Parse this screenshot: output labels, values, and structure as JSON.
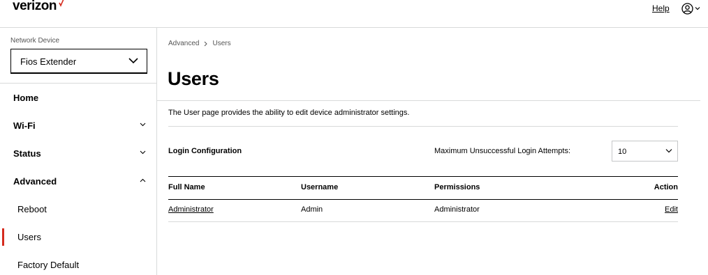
{
  "header": {
    "logo_text": "verizon",
    "help_label": "Help",
    "brand_color": "#d52b1e",
    "user_icon": "user-circle-icon"
  },
  "sidebar": {
    "device_label": "Network Device",
    "device_value": "Fios Extender",
    "items": [
      {
        "label": "Home"
      },
      {
        "label": "Wi-Fi",
        "expanded": false
      },
      {
        "label": "Status",
        "expanded": false
      },
      {
        "label": "Advanced",
        "expanded": true
      }
    ],
    "sub_items": [
      {
        "label": "Reboot",
        "active": false
      },
      {
        "label": "Users",
        "active": true
      },
      {
        "label": "Factory Default",
        "active": false
      }
    ]
  },
  "main": {
    "breadcrumb": [
      "Advanced",
      "Users"
    ],
    "title": "Users",
    "description": "The User page provides the ability to edit device administrator settings.",
    "login_config_label": "Login Configuration",
    "max_attempts_label": "Maximum Unsuccessful Login Attempts:",
    "max_attempts_value": "10",
    "table": {
      "headers": [
        "Full Name",
        "Username",
        "Permissions",
        "Action"
      ],
      "rows": [
        {
          "full_name": "Administrator",
          "username": "Admin",
          "permissions": "Administrator",
          "action": "Edit"
        }
      ]
    }
  }
}
